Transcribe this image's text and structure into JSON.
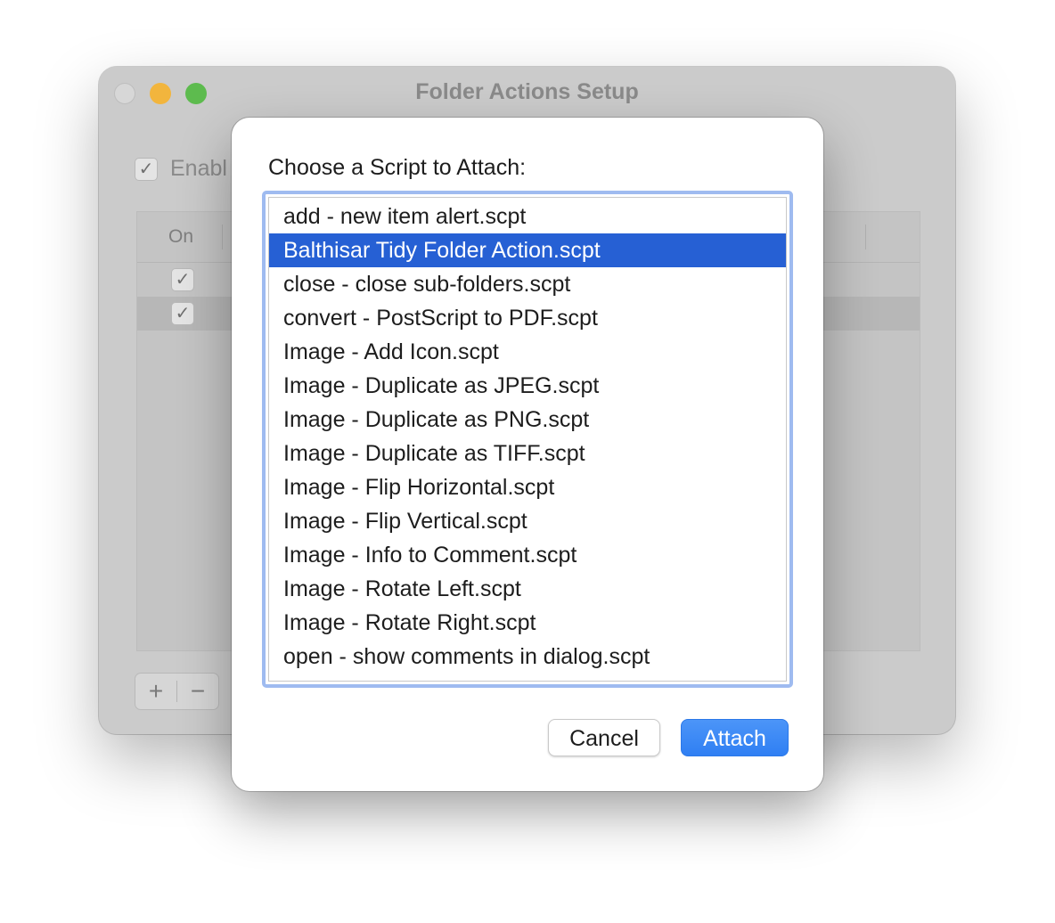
{
  "window": {
    "title": "Folder Actions Setup",
    "enable_label": "Enabl",
    "enable_check": "✓",
    "table": {
      "col_on": "On",
      "rows": [
        {
          "checked": "✓"
        },
        {
          "checked": "✓"
        }
      ]
    },
    "add_label": "+",
    "remove_label": "−"
  },
  "dialog": {
    "prompt": "Choose a Script to Attach:",
    "selected_index": 1,
    "items": [
      "add - new item alert.scpt",
      "Balthisar Tidy Folder Action.scpt",
      "close - close sub-folders.scpt",
      "convert - PostScript to PDF.scpt",
      "Image - Add Icon.scpt",
      "Image - Duplicate as JPEG.scpt",
      "Image - Duplicate as PNG.scpt",
      "Image - Duplicate as TIFF.scpt",
      "Image - Flip Horizontal.scpt",
      "Image - Flip Vertical.scpt",
      "Image - Info to Comment.scpt",
      "Image - Rotate Left.scpt",
      "Image - Rotate Right.scpt",
      "open - show comments in dialog.scpt"
    ],
    "cancel_label": "Cancel",
    "attach_label": "Attach"
  },
  "colors": {
    "selection": "#2660d4",
    "accent": "#2f7ff3",
    "focus_ring": "#9fbbf0"
  }
}
